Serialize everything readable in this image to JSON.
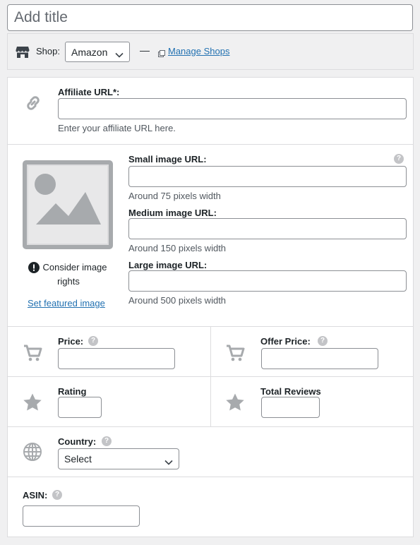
{
  "title": {
    "placeholder": "Add title"
  },
  "shop": {
    "label": "Shop:",
    "selected": "Amazon",
    "separator": "—",
    "manage_label": "Manage Shops"
  },
  "affiliate": {
    "label": "Affiliate URL*:",
    "value": "",
    "description": "Enter your affiliate URL here."
  },
  "images": {
    "small": {
      "label": "Small image URL:",
      "value": "",
      "description": "Around 75 pixels width"
    },
    "medium": {
      "label": "Medium image URL:",
      "value": "",
      "description": "Around 150 pixels width"
    },
    "large": {
      "label": "Large image URL:",
      "value": "",
      "description": "Around 500 pixels width"
    },
    "rights_note": "Consider image rights",
    "set_featured_label": "Set featured image"
  },
  "price": {
    "label": "Price:",
    "value": ""
  },
  "offer_price": {
    "label": "Offer Price:",
    "value": ""
  },
  "rating": {
    "label": "Rating",
    "value": ""
  },
  "total_reviews": {
    "label": "Total Reviews",
    "value": ""
  },
  "country": {
    "label": "Country:",
    "selected": "Select"
  },
  "asin": {
    "label": "ASIN:",
    "value": ""
  },
  "help_glyph": "?",
  "colors": {
    "link": "#2271b1",
    "icon": "#a7aaad",
    "border": "#dcdcde",
    "input_border": "#8c8f94"
  }
}
